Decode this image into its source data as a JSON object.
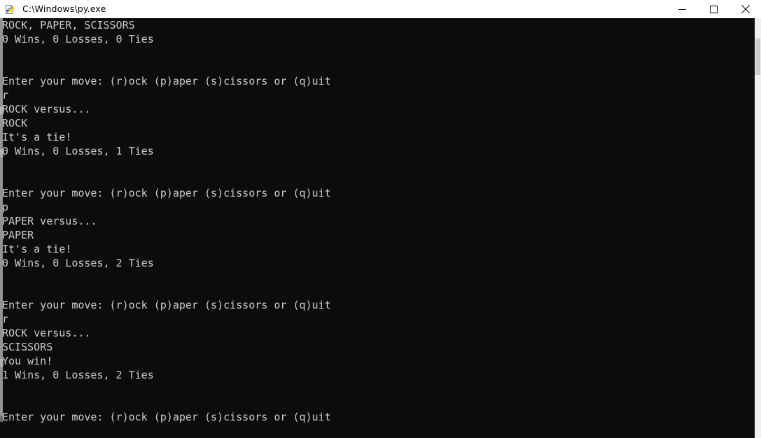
{
  "window": {
    "title": "C:\\Windows\\py.exe",
    "icon": "python-launcher-icon",
    "titlebar_bg": "#ffffff",
    "titlebar_fg": "#000000",
    "console_bg": "#0c0c0c",
    "console_fg": "#cccccc"
  },
  "controls": {
    "minimize_label": "Minimize",
    "maximize_label": "Maximize",
    "close_label": "Close"
  },
  "console": {
    "lines": [
      "ROCK, PAPER, SCISSORS",
      "0 Wins, 0 Losses, 0 Ties",
      "",
      "",
      "Enter your move: (r)ock (p)aper (s)cissors or (q)uit",
      "r",
      "ROCK versus...",
      "ROCK",
      "It's a tie!",
      "0 Wins, 0 Losses, 1 Ties",
      "",
      "",
      "Enter your move: (r)ock (p)aper (s)cissors or (q)uit",
      "p",
      "PAPER versus...",
      "PAPER",
      "It's a tie!",
      "0 Wins, 0 Losses, 2 Ties",
      "",
      "",
      "Enter your move: (r)ock (p)aper (s)cissors or (q)uit",
      "r",
      "ROCK versus...",
      "SCISSORS",
      "You win!",
      "1 Wins, 0 Losses, 2 Ties",
      "",
      "",
      "Enter your move: (r)ock (p)aper (s)cissors or (q)uit"
    ],
    "text": "ROCK, PAPER, SCISSORS\n0 Wins, 0 Losses, 0 Ties\n\n\nEnter your move: (r)ock (p)aper (s)cissors or (q)uit\nr\nROCK versus...\nROCK\nIt's a tie!\n0 Wins, 0 Losses, 1 Ties\n\n\nEnter your move: (r)ock (p)aper (s)cissors or (q)uit\np\nPAPER versus...\nPAPER\nIt's a tie!\n0 Wins, 0 Losses, 2 Ties\n\n\nEnter your move: (r)ock (p)aper (s)cissors or (q)uit\nr\nROCK versus...\nSCISSORS\nYou win!\n1 Wins, 0 Losses, 2 Ties\n\n\nEnter your move: (r)ock (p)aper (s)cissors or (q)uit",
    "game_state": {
      "wins": 1,
      "losses": 0,
      "ties": 2
    },
    "prompt": "Enter your move: (r)ock (p)aper (s)cissors or (q)uit"
  },
  "scrollbar": {
    "track_color": "#f0f0f0",
    "thumb_color": "#cdcdcd"
  }
}
